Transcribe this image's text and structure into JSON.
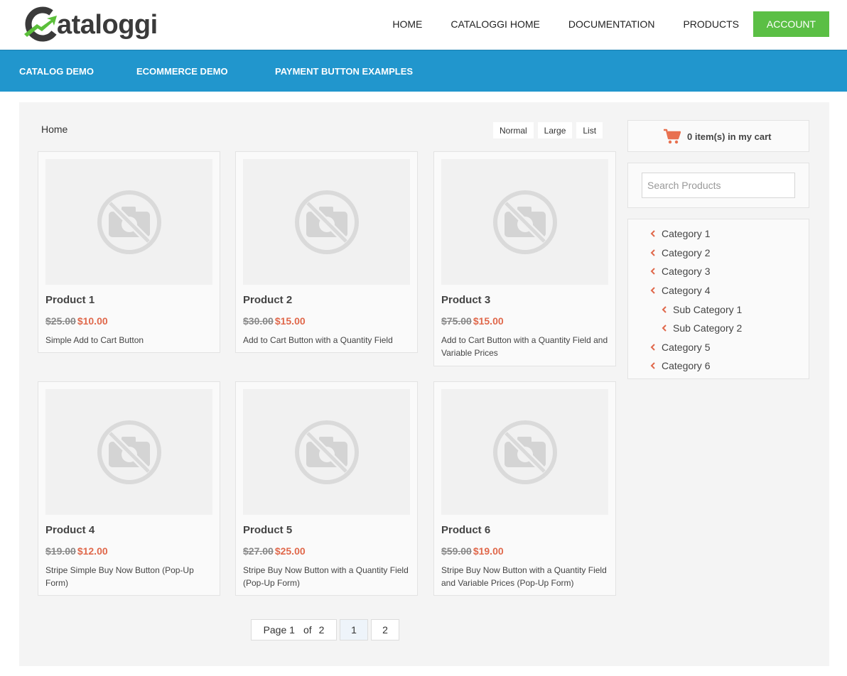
{
  "logo": {
    "text_pre": "C",
    "text_rest": "ataloggi",
    "name": "Cataloggi"
  },
  "topnav": {
    "items": [
      "HOME",
      "CATALOGGI HOME",
      "DOCUMENTATION",
      "PRODUCTS"
    ],
    "account": "ACCOUNT"
  },
  "subnav": {
    "items": [
      "CATALOG DEMO",
      "ECOMMERCE DEMO",
      "PAYMENT BUTTON EXAMPLES"
    ]
  },
  "breadcrumb": "Home",
  "view_options": [
    "Normal",
    "Large",
    "List"
  ],
  "products": [
    {
      "name": "Product 1",
      "old_price": "$25.00",
      "price": "$10.00",
      "desc": "Simple Add to Cart Button"
    },
    {
      "name": "Product 2",
      "old_price": "$30.00",
      "price": "$15.00",
      "desc": "Add to Cart Button with a Quantity Field"
    },
    {
      "name": "Product 3",
      "old_price": "$75.00",
      "price": "$15.00",
      "desc": "Add to Cart Button with a Quantity Field and Variable Prices"
    },
    {
      "name": "Product 4",
      "old_price": "$19.00",
      "price": "$12.00",
      "desc": "Stripe Simple Buy Now Button (Pop-Up Form)"
    },
    {
      "name": "Product 5",
      "old_price": "$27.00",
      "price": "$25.00",
      "desc": "Stripe Buy Now Button with a Quantity Field (Pop-Up Form)"
    },
    {
      "name": "Product 6",
      "old_price": "$59.00",
      "price": "$19.00",
      "desc": "Stripe Buy Now Button with a Quantity Field and Variable Prices (Pop-Up Form)"
    }
  ],
  "pagination": {
    "label": "Page 1",
    "of": "of",
    "total": "2",
    "pages": [
      "1",
      "2"
    ]
  },
  "cart": {
    "text": "0 item(s) in my cart"
  },
  "search": {
    "placeholder": "Search Products"
  },
  "categories": [
    "Category 1",
    "Category 2",
    "Category 3",
    "Category 4",
    "Sub Category 1",
    "Sub Category 2",
    "Category 5",
    "Category 6"
  ],
  "colors": {
    "accent_blue": "#2196cd",
    "accent_green": "#5bbf45",
    "price_red": "#e0684b"
  }
}
